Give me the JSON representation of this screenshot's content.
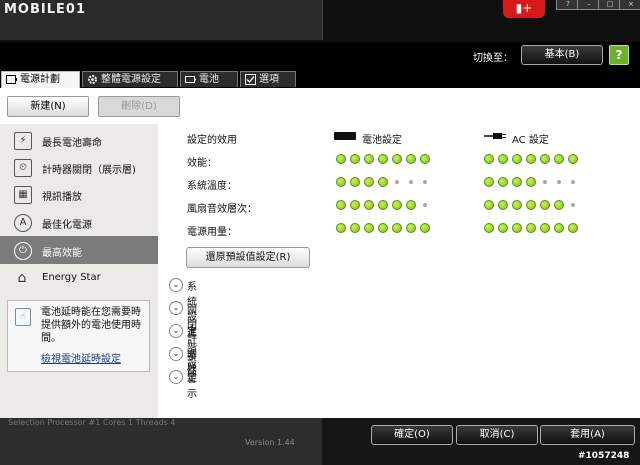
{
  "logo_text": "MOBILE01",
  "window_controls": [
    "?",
    "–",
    "□",
    "×"
  ],
  "switcher": {
    "label": "切換至：",
    "button": "基本(B)"
  },
  "tabs": [
    {
      "label": "電源計劃",
      "icon": "battery-outline-icon"
    },
    {
      "label": "整體電源設定",
      "icon": "gear-icon"
    },
    {
      "label": "電池",
      "icon": "battery-icon"
    },
    {
      "label": "選項",
      "icon": "checkbox-icon"
    }
  ],
  "toolbar": {
    "new": "新建(N)",
    "delete": "刪除(D)"
  },
  "sidebar": {
    "items": [
      {
        "label": "最長電池壽命",
        "icon": "battery-plug-icon",
        "glyph": "⚡"
      },
      {
        "label": "計時器關閉（展示層)",
        "icon": "timer-off-icon",
        "glyph": "⏲"
      },
      {
        "label": "視訊播放",
        "icon": "film-icon",
        "glyph": "▦"
      },
      {
        "label": "最佳化電源",
        "icon": "optimize-icon",
        "glyph": "A"
      },
      {
        "label": "最高效能",
        "icon": "power-icon",
        "glyph": "⏻"
      },
      {
        "label": "Energy Star",
        "icon": "energy-star-icon",
        "glyph": "⌂"
      }
    ],
    "selected": 4,
    "info": {
      "text": "電池延時能在您需要時提供額外的電池使用時間。",
      "link": "檢視電池延時設定"
    }
  },
  "content": {
    "header": "設定的效用",
    "battery_header": "電池設定",
    "ac_header": "AC 設定",
    "rows": [
      {
        "label": "效能：",
        "battery": 7,
        "ac": 7
      },
      {
        "label": "系統溫度：",
        "battery": 4,
        "ac": 4
      },
      {
        "label": "風扇音效層次：",
        "battery": 6,
        "ac": 6
      },
      {
        "label": "電源用量：",
        "battery": 7,
        "ac": 7
      }
    ],
    "max_dots": 7,
    "restore_button": "還原預設值設定(R)",
    "sections": [
      "系統設定",
      "關閉計時器",
      "進階設定",
      "事件",
      "警示"
    ]
  },
  "footer": {
    "ok": "確定(O)",
    "cancel": "取消(C)",
    "apply": "套用(A)"
  },
  "background_text": {
    "selection": "Selection  Processor #1     Cores  1     Threads  4",
    "version": "Version 1.44"
  },
  "watermark": "#1057248"
}
